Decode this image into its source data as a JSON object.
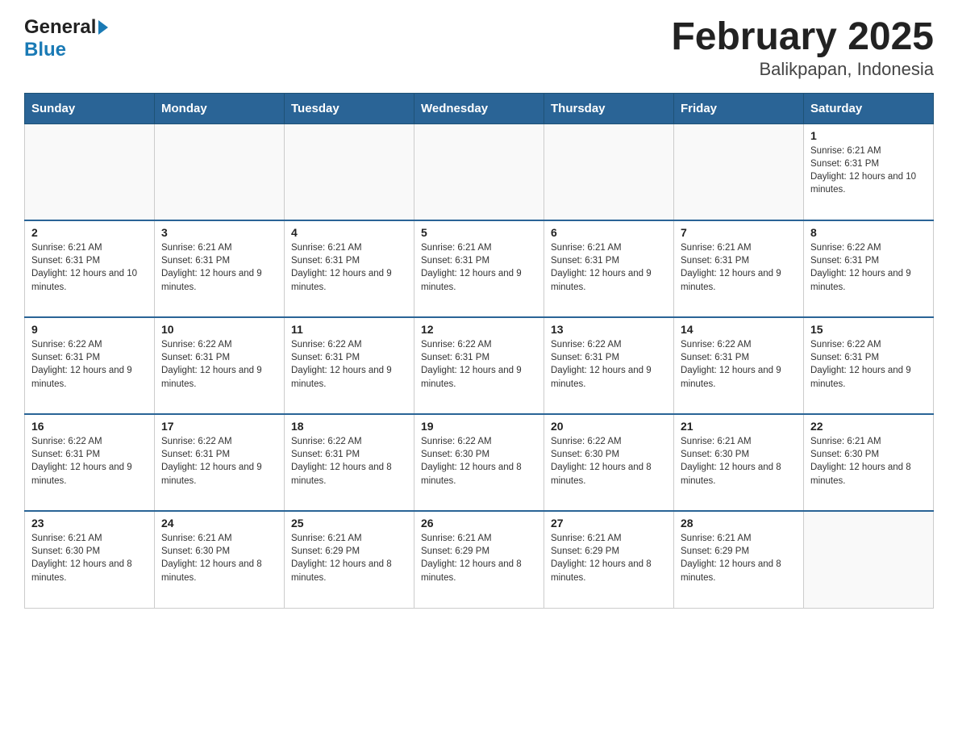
{
  "logo": {
    "general": "General",
    "blue": "Blue"
  },
  "title": "February 2025",
  "location": "Balikpapan, Indonesia",
  "days_of_week": [
    "Sunday",
    "Monday",
    "Tuesday",
    "Wednesday",
    "Thursday",
    "Friday",
    "Saturday"
  ],
  "weeks": [
    {
      "days": [
        {
          "number": "",
          "info": ""
        },
        {
          "number": "",
          "info": ""
        },
        {
          "number": "",
          "info": ""
        },
        {
          "number": "",
          "info": ""
        },
        {
          "number": "",
          "info": ""
        },
        {
          "number": "",
          "info": ""
        },
        {
          "number": "1",
          "info": "Sunrise: 6:21 AM\nSunset: 6:31 PM\nDaylight: 12 hours and 10 minutes."
        }
      ]
    },
    {
      "days": [
        {
          "number": "2",
          "info": "Sunrise: 6:21 AM\nSunset: 6:31 PM\nDaylight: 12 hours and 10 minutes."
        },
        {
          "number": "3",
          "info": "Sunrise: 6:21 AM\nSunset: 6:31 PM\nDaylight: 12 hours and 9 minutes."
        },
        {
          "number": "4",
          "info": "Sunrise: 6:21 AM\nSunset: 6:31 PM\nDaylight: 12 hours and 9 minutes."
        },
        {
          "number": "5",
          "info": "Sunrise: 6:21 AM\nSunset: 6:31 PM\nDaylight: 12 hours and 9 minutes."
        },
        {
          "number": "6",
          "info": "Sunrise: 6:21 AM\nSunset: 6:31 PM\nDaylight: 12 hours and 9 minutes."
        },
        {
          "number": "7",
          "info": "Sunrise: 6:21 AM\nSunset: 6:31 PM\nDaylight: 12 hours and 9 minutes."
        },
        {
          "number": "8",
          "info": "Sunrise: 6:22 AM\nSunset: 6:31 PM\nDaylight: 12 hours and 9 minutes."
        }
      ]
    },
    {
      "days": [
        {
          "number": "9",
          "info": "Sunrise: 6:22 AM\nSunset: 6:31 PM\nDaylight: 12 hours and 9 minutes."
        },
        {
          "number": "10",
          "info": "Sunrise: 6:22 AM\nSunset: 6:31 PM\nDaylight: 12 hours and 9 minutes."
        },
        {
          "number": "11",
          "info": "Sunrise: 6:22 AM\nSunset: 6:31 PM\nDaylight: 12 hours and 9 minutes."
        },
        {
          "number": "12",
          "info": "Sunrise: 6:22 AM\nSunset: 6:31 PM\nDaylight: 12 hours and 9 minutes."
        },
        {
          "number": "13",
          "info": "Sunrise: 6:22 AM\nSunset: 6:31 PM\nDaylight: 12 hours and 9 minutes."
        },
        {
          "number": "14",
          "info": "Sunrise: 6:22 AM\nSunset: 6:31 PM\nDaylight: 12 hours and 9 minutes."
        },
        {
          "number": "15",
          "info": "Sunrise: 6:22 AM\nSunset: 6:31 PM\nDaylight: 12 hours and 9 minutes."
        }
      ]
    },
    {
      "days": [
        {
          "number": "16",
          "info": "Sunrise: 6:22 AM\nSunset: 6:31 PM\nDaylight: 12 hours and 9 minutes."
        },
        {
          "number": "17",
          "info": "Sunrise: 6:22 AM\nSunset: 6:31 PM\nDaylight: 12 hours and 9 minutes."
        },
        {
          "number": "18",
          "info": "Sunrise: 6:22 AM\nSunset: 6:31 PM\nDaylight: 12 hours and 8 minutes."
        },
        {
          "number": "19",
          "info": "Sunrise: 6:22 AM\nSunset: 6:30 PM\nDaylight: 12 hours and 8 minutes."
        },
        {
          "number": "20",
          "info": "Sunrise: 6:22 AM\nSunset: 6:30 PM\nDaylight: 12 hours and 8 minutes."
        },
        {
          "number": "21",
          "info": "Sunrise: 6:21 AM\nSunset: 6:30 PM\nDaylight: 12 hours and 8 minutes."
        },
        {
          "number": "22",
          "info": "Sunrise: 6:21 AM\nSunset: 6:30 PM\nDaylight: 12 hours and 8 minutes."
        }
      ]
    },
    {
      "days": [
        {
          "number": "23",
          "info": "Sunrise: 6:21 AM\nSunset: 6:30 PM\nDaylight: 12 hours and 8 minutes."
        },
        {
          "number": "24",
          "info": "Sunrise: 6:21 AM\nSunset: 6:30 PM\nDaylight: 12 hours and 8 minutes."
        },
        {
          "number": "25",
          "info": "Sunrise: 6:21 AM\nSunset: 6:29 PM\nDaylight: 12 hours and 8 minutes."
        },
        {
          "number": "26",
          "info": "Sunrise: 6:21 AM\nSunset: 6:29 PM\nDaylight: 12 hours and 8 minutes."
        },
        {
          "number": "27",
          "info": "Sunrise: 6:21 AM\nSunset: 6:29 PM\nDaylight: 12 hours and 8 minutes."
        },
        {
          "number": "28",
          "info": "Sunrise: 6:21 AM\nSunset: 6:29 PM\nDaylight: 12 hours and 8 minutes."
        },
        {
          "number": "",
          "info": ""
        }
      ]
    }
  ]
}
